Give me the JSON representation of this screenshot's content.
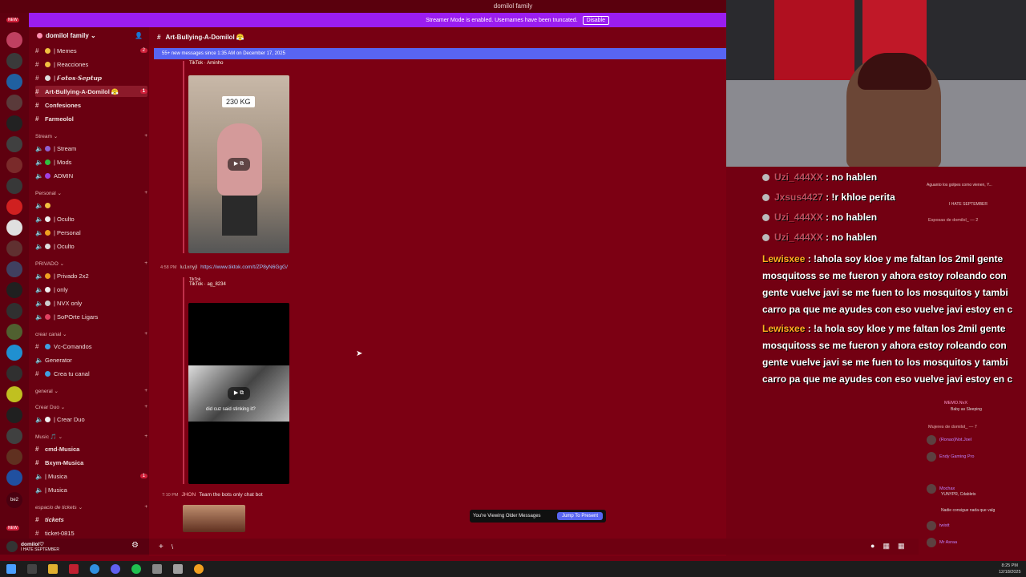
{
  "window": {
    "title": "domilol family"
  },
  "streamer_mode": {
    "text": "Streamer Mode is enabled. Usernames have been truncated.",
    "disable_label": "Disable"
  },
  "rail": {
    "new_top": "NEW",
    "new_bottom": "NEW",
    "text_icon": "be2"
  },
  "server": {
    "name": "domilol family ⌄"
  },
  "channels": {
    "top": [
      {
        "label": "| Memes",
        "badge": "2"
      },
      {
        "label": "| Reacciones",
        "badge": ""
      },
      {
        "label": "| 𝙁𝙤𝙩𝙤𝙨-𝙎𝙚𝙥𝙩𝙪𝙥",
        "badge": ""
      },
      {
        "label": "Art-Bullying-A-Domilol 😤",
        "badge": "1"
      },
      {
        "label": "Confesiones",
        "badge": ""
      },
      {
        "label": "Farmeolol",
        "badge": ""
      }
    ],
    "cat_stream": "Stream ⌄",
    "stream": [
      "| Stream",
      "| Mods",
      "ADMIN"
    ],
    "cat_personal": "Personal ⌄",
    "personal": [
      "",
      "| Oculto",
      "| Personal",
      "| Oculto"
    ],
    "cat_privado": "PRIVADO ⌄",
    "privado": [
      "| Privado 2x2",
      "| only",
      "| NVX only",
      "| SoPOrte Ligars"
    ],
    "cat_crear": "crear canal ⌄",
    "crear": [
      "Vc-Comandos",
      "Generator",
      "Crea tu canal"
    ],
    "cat_general": "general ⌄",
    "cat_crearduo": "Crear Duo ⌄",
    "crearduo": [
      "| Crear Duo"
    ],
    "cat_music": "Music 🎵 ⌄",
    "music": [
      {
        "label": "cmd-Musica",
        "badge": ""
      },
      {
        "label": "Bxym-Musica",
        "badge": ""
      },
      {
        "label": "| Musica",
        "badge": "1"
      },
      {
        "label": "| Musica",
        "badge": ""
      }
    ],
    "cat_tickets": "espacio de tickets ⌄",
    "tickets": [
      "tickets",
      "ticket-0815"
    ]
  },
  "user": {
    "name": "domilol♡",
    "status": "I HATE SEPTEMBER"
  },
  "chat": {
    "channel_name": "Art-Bullying-A-Domilol 😤",
    "new_messages": "55+ new messages since 1:35 AM on December 17, 2025",
    "embed1_author": "TikTok · Aminho",
    "embed1_overlay": "230 KG",
    "msg_time": "4:58 PM",
    "msg_user": "lu1xnyjl",
    "msg_link": "https://www.tiktok.com/t/ZP8yN6GgG/",
    "embed2_site": "TikTok",
    "embed2_author": "TikTok · ag_8234",
    "embed2_caption": "did cuz said stinking it?",
    "msg2_time": "7:10 PM",
    "msg2_user": "JHON",
    "msg2_text": "Team the bots only chat bot",
    "older_text": "You're Viewing Older Messages",
    "jump_label": "Jump To Present"
  },
  "composer": {
    "plus": "+",
    "value": "\\"
  },
  "stream_chat": [
    {
      "user": "Uzi_444XX",
      "sep": " : ",
      "text": "no hablen",
      "color": "gray"
    },
    {
      "user": "Jxsus4427",
      "sep": " : ",
      "text": "!r khloe perita",
      "color": "gray"
    },
    {
      "user": "Uzi_444XX",
      "sep": " : ",
      "text": "no hablen",
      "color": "gray"
    },
    {
      "user": "Uzi_444XX",
      "sep": " : ",
      "text": "no hablen",
      "color": "gray"
    },
    {
      "user": "Lewisxee",
      "sep": " : ",
      "text": "!ahola soy kloe y me faltan los 2mil gente",
      "color": "orange"
    },
    {
      "user": "",
      "sep": "",
      "text": "mosquitoss se me fueron y ahora estoy roleando con",
      "color": "none"
    },
    {
      "user": "",
      "sep": "",
      "text": "gente vuelve javi se me fuen to los mosquitos y tambi",
      "color": "none"
    },
    {
      "user": "",
      "sep": "",
      "text": "carro pa que me ayudes con eso vuelve javi estoy en c",
      "color": "none"
    },
    {
      "user": "Lewisxee",
      "sep": " : ",
      "text": "!a hola soy kloe y me faltan los 2mil gente",
      "color": "orange"
    },
    {
      "user": "",
      "sep": "",
      "text": "mosquitoss se me fueron y ahora estoy roleando con",
      "color": "none"
    },
    {
      "user": "",
      "sep": "",
      "text": "gente vuelve javi se me fuen to los mosquitos y tambi",
      "color": "none"
    },
    {
      "user": "",
      "sep": "",
      "text": "carro pa que me ayudes con eso vuelve javi estoy en c",
      "color": "none"
    }
  ],
  "members": {
    "top1": "Aguanto los golpes como vienen, Y...",
    "top2": "I HATE SEPTEMBER",
    "cat1": "Esposas de domilol_ — 2",
    "cat2": "Mujeres de domilol_ — 7",
    "list": [
      "(Ronao)Not.Joel",
      "Endy Gaming Pro",
      "twistt",
      "Mr Asraa"
    ],
    "mid": [
      "MEMO.NvX",
      "Baby as Sleeping",
      "papolo20_nvx"
    ],
    "lower": [
      "Mochax",
      "YUNYPR, Cdablets",
      "Nadie consigue nada que valg"
    ]
  },
  "taskbar": {
    "time": "8:25 PM",
    "date": "12/18/2025"
  },
  "colors": {
    "accent": "#5865f2",
    "streamer": "#9b1df0",
    "bg": "#7c0013"
  }
}
